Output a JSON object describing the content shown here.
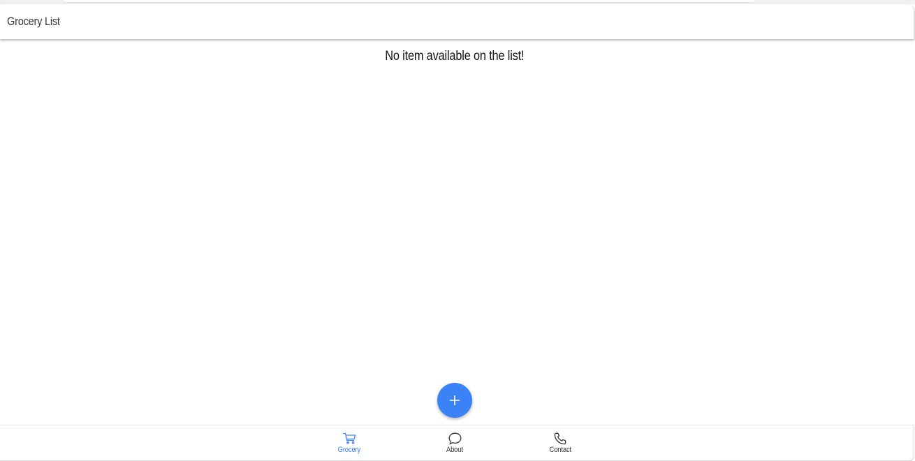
{
  "header": {
    "title": "Grocery List"
  },
  "main": {
    "empty_message": "No item available on the list!"
  },
  "fab": {
    "icon": "plus-icon",
    "color": "#3b82f6"
  },
  "bottom_nav": {
    "active_color": "#3b82f6",
    "inactive_color": "#333333",
    "items": [
      {
        "label": "Grocery",
        "icon": "cart-icon",
        "active": true
      },
      {
        "label": "About",
        "icon": "chat-bubble-icon",
        "active": false
      },
      {
        "label": "Contact",
        "icon": "phone-icon",
        "active": false
      }
    ]
  }
}
